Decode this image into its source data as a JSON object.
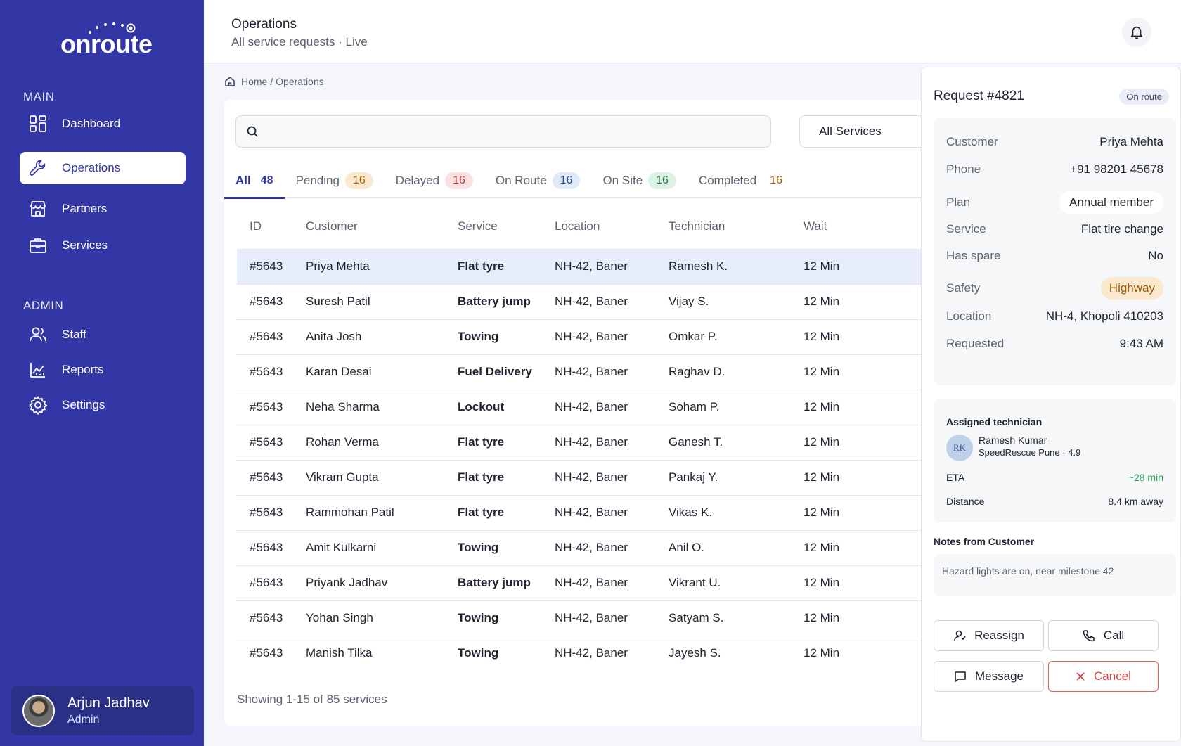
{
  "brand": {
    "name": "onroute"
  },
  "sidebar": {
    "main_label": "MAIN",
    "admin_label": "ADMIN",
    "main_items": [
      {
        "label": "Dashboard",
        "icon": "dashboard-icon"
      },
      {
        "label": "Operations",
        "icon": "wrench-icon",
        "active": true
      },
      {
        "label": "Partners",
        "icon": "storefront-icon"
      },
      {
        "label": "Services",
        "icon": "briefcase-icon"
      }
    ],
    "admin_items": [
      {
        "label": "Staff",
        "icon": "users-icon"
      },
      {
        "label": "Reports",
        "icon": "chart-icon"
      },
      {
        "label": "Settings",
        "icon": "gear-icon"
      }
    ],
    "user": {
      "name": "Arjun Jadhav",
      "role": "Admin"
    }
  },
  "header": {
    "title": "Operations",
    "subtitle": "All service requests · Live"
  },
  "breadcrumb": {
    "home": "Home",
    "current": "/ Operations"
  },
  "search": {
    "placeholder": "",
    "value": ""
  },
  "filter": {
    "selected": "All Services"
  },
  "tabs": [
    {
      "label": "All",
      "count": "48",
      "active": true,
      "bg": "",
      "fg": "#3237a5"
    },
    {
      "label": "Pending",
      "count": "16",
      "bg": "#fbe9cf",
      "fg": "#9b5a00"
    },
    {
      "label": "Delayed",
      "count": "16",
      "bg": "#fbe1e1",
      "fg": "#b23a3a"
    },
    {
      "label": "On Route",
      "count": "16",
      "bg": "#dfe9f8",
      "fg": "#2b4f8c"
    },
    {
      "label": "On Site",
      "count": "16",
      "bg": "#dcf2e5",
      "fg": "#1f6d42"
    },
    {
      "label": "Completed",
      "count": "16",
      "bg": "transparent",
      "fg": "#9b5a00"
    }
  ],
  "table": {
    "columns": [
      "ID",
      "Customer",
      "Service",
      "Location",
      "Technician",
      "Wait"
    ],
    "rows": [
      [
        "#5643",
        "Priya Mehta",
        "Flat tyre",
        "NH-42, Baner",
        "Ramesh K.",
        "12 Min"
      ],
      [
        "#5643",
        "Suresh Patil",
        "Battery jump",
        "NH-42, Baner",
        "Vijay S.",
        "12 Min"
      ],
      [
        "#5643",
        "Anita Josh",
        "Towing",
        "NH-42, Baner",
        "Omkar P.",
        "12 Min"
      ],
      [
        "#5643",
        "Karan Desai",
        "Fuel Delivery",
        "NH-42, Baner",
        "Raghav D.",
        "12 Min"
      ],
      [
        "#5643",
        "Neha Sharma",
        "Lockout",
        "NH-42, Baner",
        "Soham P.",
        "12 Min"
      ],
      [
        "#5643",
        "Rohan Verma",
        "Flat tyre",
        "NH-42, Baner",
        "Ganesh T.",
        "12 Min"
      ],
      [
        "#5643",
        "Vikram Gupta",
        "Flat tyre",
        "NH-42, Baner",
        "Pankaj Y.",
        "12 Min"
      ],
      [
        "#5643",
        "Rammohan Patil",
        "Flat tyre",
        "NH-42, Baner",
        "Vikas K.",
        "12 Min"
      ],
      [
        "#5643",
        "Amit Kulkarni",
        "Towing",
        "NH-42, Baner",
        "Anil O.",
        "12 Min"
      ],
      [
        "#5643",
        "Priyank Jadhav",
        "Battery jump",
        "NH-42, Baner",
        "Vikrant U.",
        "12 Min"
      ],
      [
        "#5643",
        "Yohan Singh",
        "Towing",
        "NH-42, Baner",
        "Satyam S.",
        "12 Min"
      ],
      [
        "#5643",
        "Manish Tilka",
        "Towing",
        "NH-42, Baner",
        "Jayesh S.",
        "12 Min"
      ]
    ],
    "footer": "Showing 1-15 of 85 services"
  },
  "detail": {
    "title": "Request #4821",
    "status": "On route",
    "fields": [
      {
        "k": "Customer",
        "v": "Priya Mehta",
        "style": ""
      },
      {
        "k": "Phone",
        "v": "+91 98201 45678",
        "style": ""
      },
      {
        "k": "Plan",
        "v": "Annual member",
        "style": "pill-white"
      },
      {
        "k": "Service",
        "v": "Flat tire change",
        "style": ""
      },
      {
        "k": "Has spare",
        "v": "No",
        "style": ""
      },
      {
        "k": "Safety",
        "v": "Highway",
        "style": "pill-amber"
      },
      {
        "k": "Location",
        "v": "NH-4, Khopoli 410203",
        "style": ""
      },
      {
        "k": "Requested",
        "v": "9:43 AM",
        "style": ""
      }
    ],
    "technician": {
      "heading": "Assigned technician",
      "initials": "RK",
      "name": "Ramesh Kumar",
      "meta": "SpeedRescue Pune · 4.9",
      "eta_label": "ETA",
      "eta_value": "~28 min",
      "distance_label": "Distance",
      "distance_value": "8.4 km away"
    },
    "notes_label": "Notes from Customer",
    "notes": "Hazard lights are on, near milestone 42",
    "actions": {
      "reassign": "Reassign",
      "call": "Call",
      "message": "Message",
      "cancel": "Cancel"
    }
  },
  "colors": {
    "sidebar": "#3237a5",
    "accent": "#3237a5",
    "danger": "#d64545",
    "eta": "#22a35a"
  }
}
